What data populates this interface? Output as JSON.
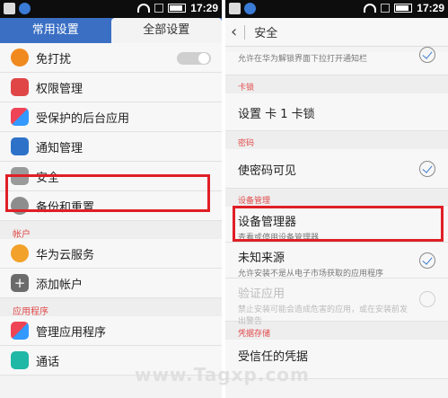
{
  "left": {
    "status": {
      "time": "17:29"
    },
    "tabs": [
      "常用设置",
      "全部设置"
    ],
    "rows": [
      {
        "label": "免打扰"
      },
      {
        "label": "权限管理"
      },
      {
        "label": "受保护的后台应用"
      },
      {
        "label": "通知管理"
      },
      {
        "label": "安全"
      },
      {
        "label": "备份和重置"
      }
    ],
    "section_account": "帐户",
    "account_rows": [
      {
        "label": "华为云服务"
      },
      {
        "label": "添加帐户"
      }
    ],
    "section_apps": "应用程序",
    "app_rows": [
      {
        "label": "管理应用程序"
      },
      {
        "label": "通话"
      }
    ]
  },
  "right": {
    "status": {
      "time": "17:29"
    },
    "title": "安全",
    "top_sub": "允许在华为解锁界面下拉打开通知栏",
    "section_sim": "卡锁",
    "sim_row": "设置 卡 1 卡锁",
    "section_password": "密码",
    "password_row": "使密码可见",
    "section_device": "设备管理",
    "device_admin": {
      "title": "设备管理器",
      "sub": "查看或停用设备管理器"
    },
    "unknown_sources": {
      "title": "未知来源",
      "sub": "允许安装不是从电子市场获取的应用程序"
    },
    "verify_apps": {
      "title": "验证应用",
      "sub": "禁止安装可能会造成危害的应用，或在安装前发出警告"
    },
    "section_storage": "凭据存储",
    "trusted_creds": {
      "title": "受信任的凭据"
    }
  },
  "watermark": "www.Tagxp.com",
  "colors": {
    "accent_tab": "#3a6fc4",
    "highlight": "#e01f26",
    "section_text": "#e24b4b"
  }
}
